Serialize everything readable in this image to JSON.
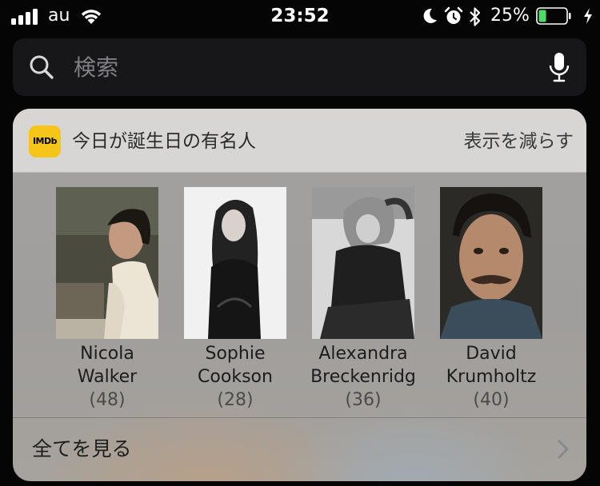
{
  "status_bar": {
    "carrier": "au",
    "time": "23:52",
    "battery_percent": "25%",
    "battery_level": 0.25,
    "icons": [
      "signal-icon",
      "wifi-icon",
      "moon-icon",
      "alarm-icon",
      "bluetooth-icon",
      "battery-icon",
      "charging-icon"
    ]
  },
  "search": {
    "placeholder": "検索"
  },
  "widget": {
    "app_logo": "IMDb",
    "title": "今日が誕生日の有名人",
    "show_less": "表示を減らす",
    "people": [
      {
        "name": "Nicola\nWalker",
        "age": "(48)"
      },
      {
        "name": "Sophie\nCookson",
        "age": "(28)"
      },
      {
        "name": "Alexandra\nBreckenridg",
        "age": "(36)"
      },
      {
        "name": "David\nKrumholtz",
        "age": "(40)"
      }
    ],
    "see_all": "全てを見る"
  },
  "colors": {
    "background": "#050506",
    "search_bar": "#17171a",
    "widget_header": "#d7d6d5",
    "imdb_yellow": "#f5c518",
    "battery_green": "#4cd964"
  }
}
